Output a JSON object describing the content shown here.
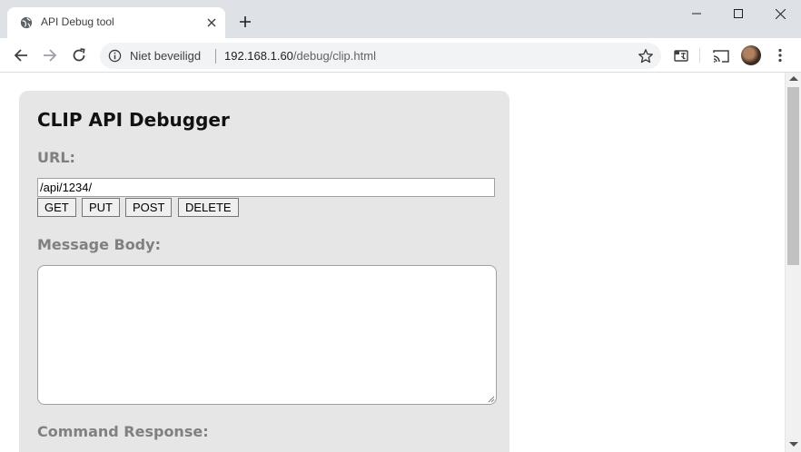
{
  "browser": {
    "tab_title": "API Debug tool",
    "security_label": "Niet beveiligd",
    "url_host": "192.168.1.60",
    "url_path": "/debug/clip.html"
  },
  "page": {
    "title": "CLIP API Debugger",
    "url_label": "URL:",
    "url_value": "/api/1234/",
    "buttons": {
      "get": "GET",
      "put": "PUT",
      "post": "POST",
      "delete": "DELETE"
    },
    "message_body_label": "Message Body:",
    "message_body_value": "",
    "command_response_label": "Command Response:"
  }
}
